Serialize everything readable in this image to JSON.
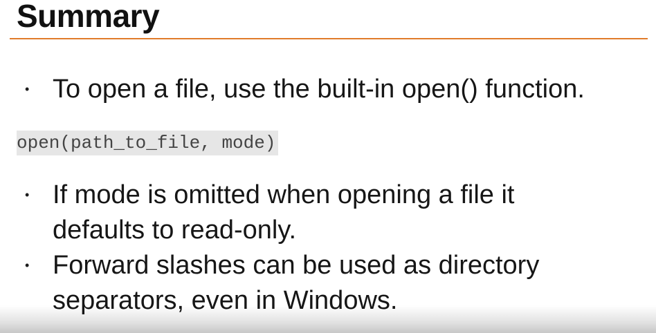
{
  "slide": {
    "title": "Summary",
    "accent_color": "#e07b2a",
    "bullets": [
      {
        "marker": "•",
        "lines": [
          "To open a file, use the built-in open() function."
        ]
      },
      {
        "marker": "•",
        "lines": [
          "If mode is omitted when opening a file it",
          "defaults to read-only."
        ]
      },
      {
        "marker": "•",
        "lines": [
          "Forward slashes can be used as directory",
          "separators, even in Windows."
        ]
      }
    ],
    "code_snippet": "open(path_to_file, mode)"
  }
}
